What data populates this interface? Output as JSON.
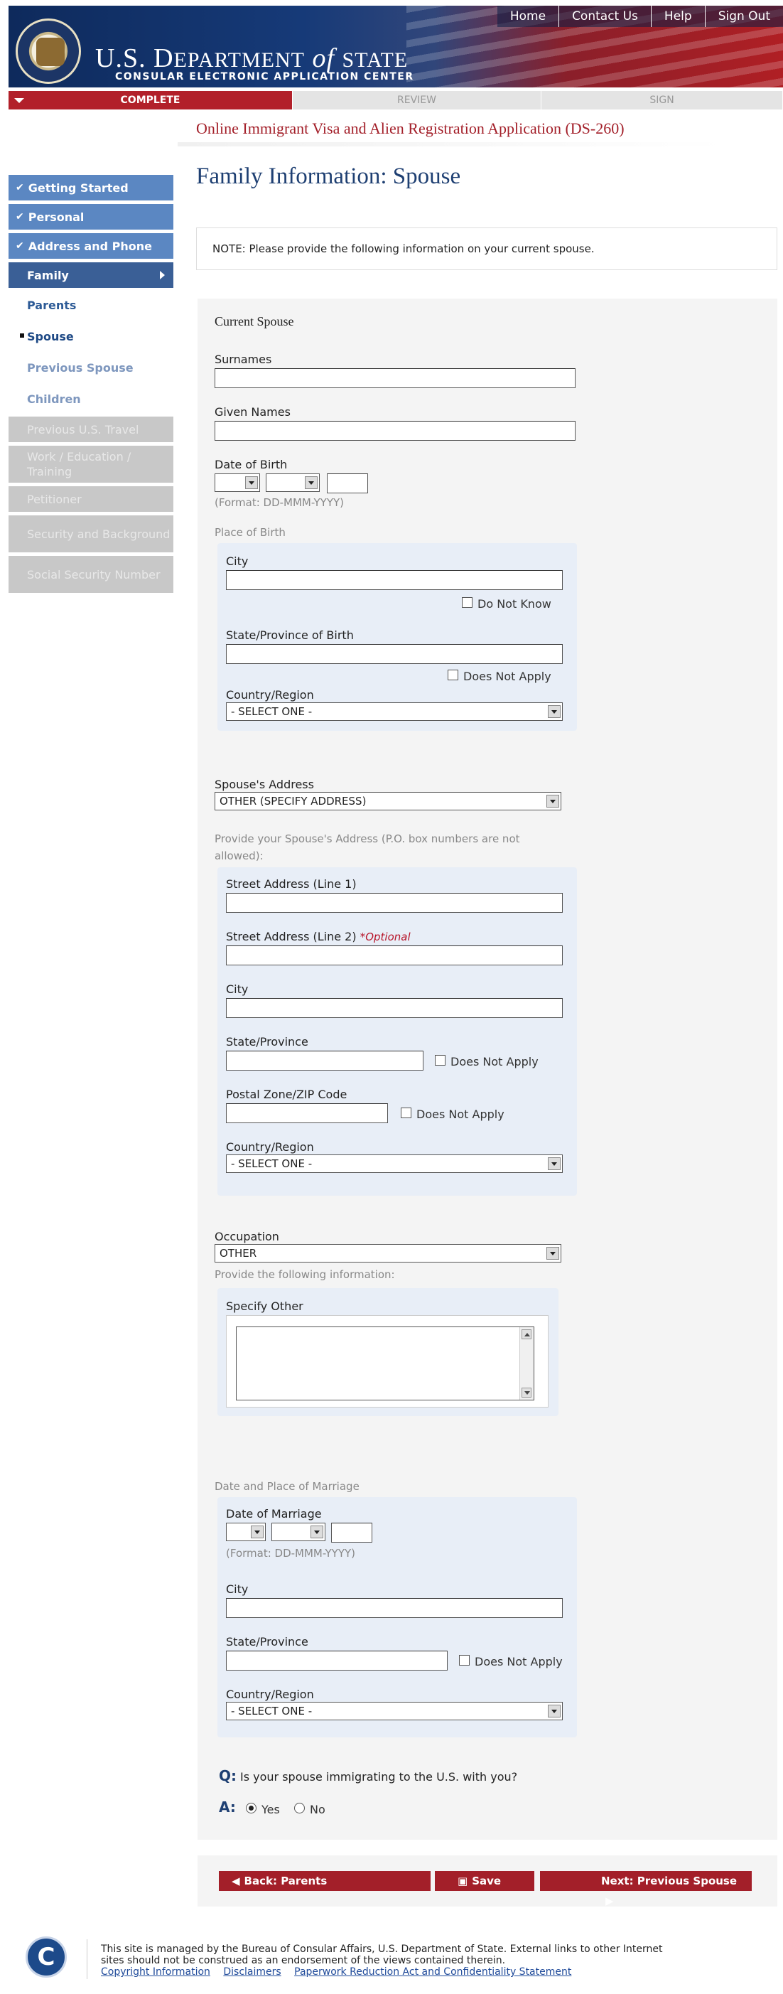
{
  "header": {
    "title_prefix": "U.S. D",
    "title_main": "EPARTMENT",
    "title_of": "of",
    "title_state": "STATE",
    "subtitle": "CONSULAR ELECTRONIC APPLICATION CENTER",
    "nav": [
      "Home",
      "Contact Us",
      "Help",
      "Sign Out"
    ]
  },
  "progress": {
    "complete": "COMPLETE",
    "review": "REVIEW",
    "sign": "SIGN"
  },
  "app_name": "Online Immigrant Visa and Alien Registration Application (DS-260)",
  "sidebar": {
    "done": [
      "Getting Started",
      "Personal",
      "Address and Phone"
    ],
    "active": "Family",
    "subs": [
      "Parents",
      "Spouse",
      "Previous Spouse",
      "Children"
    ],
    "disabled": [
      "Previous U.S. Travel",
      "Work / Education / Training",
      "Petitioner",
      "Security and Background",
      "Social Security Number"
    ]
  },
  "page_title": "Family Information: Spouse",
  "note": "NOTE: Please provide the following information on your current spouse.",
  "form": {
    "section_current": "Current Spouse",
    "surnames": "Surnames",
    "given_names": "Given Names",
    "dob": "Date of Birth",
    "dob_format": "(Format: DD-MMM-YYYY)",
    "place_of_birth": "Place of Birth",
    "city": "City",
    "do_not_know": "Do Not Know",
    "state_birth": "State/Province of Birth",
    "does_not_apply": "Does Not Apply",
    "country": "Country/Region",
    "select_one": "- SELECT ONE -",
    "spouse_address": "Spouse's Address",
    "spouse_address_value": "OTHER (SPECIFY ADDRESS)",
    "address_note": "Provide your Spouse's Address (P.O. box numbers are not allowed):",
    "street1": "Street Address (Line 1)",
    "street2": "Street Address (Line 2)",
    "optional": "*Optional",
    "state_prov": "State/Province",
    "postal": "Postal Zone/ZIP Code",
    "occupation": "Occupation",
    "occupation_value": "OTHER",
    "provide_info": "Provide the following information:",
    "specify_other": "Specify Other",
    "marriage_section": "Date and Place of Marriage",
    "date_marriage": "Date of Marriage",
    "q_label": "Q:",
    "question": "Is your spouse immigrating to the U.S. with you?",
    "a_label": "A:",
    "yes": "Yes",
    "no": "No",
    "answer": "Yes"
  },
  "buttons": {
    "back": "Back: Parents",
    "save": "Save",
    "next": "Next: Previous Spouse"
  },
  "footer": {
    "text1": "This site is managed by the Bureau of Consular Affairs, U.S. Department of State. External links to other Internet",
    "text2": "sites should not be construed as an endorsement of the views contained therein.",
    "links": [
      "Copyright Information",
      "Disclaimers",
      "Paperwork Reduction Act and Confidentiality Statement"
    ]
  },
  "colors": {
    "brand_red": "#a31f29",
    "nav_blue": "#5b87c2",
    "title_blue": "#1e3f72"
  }
}
